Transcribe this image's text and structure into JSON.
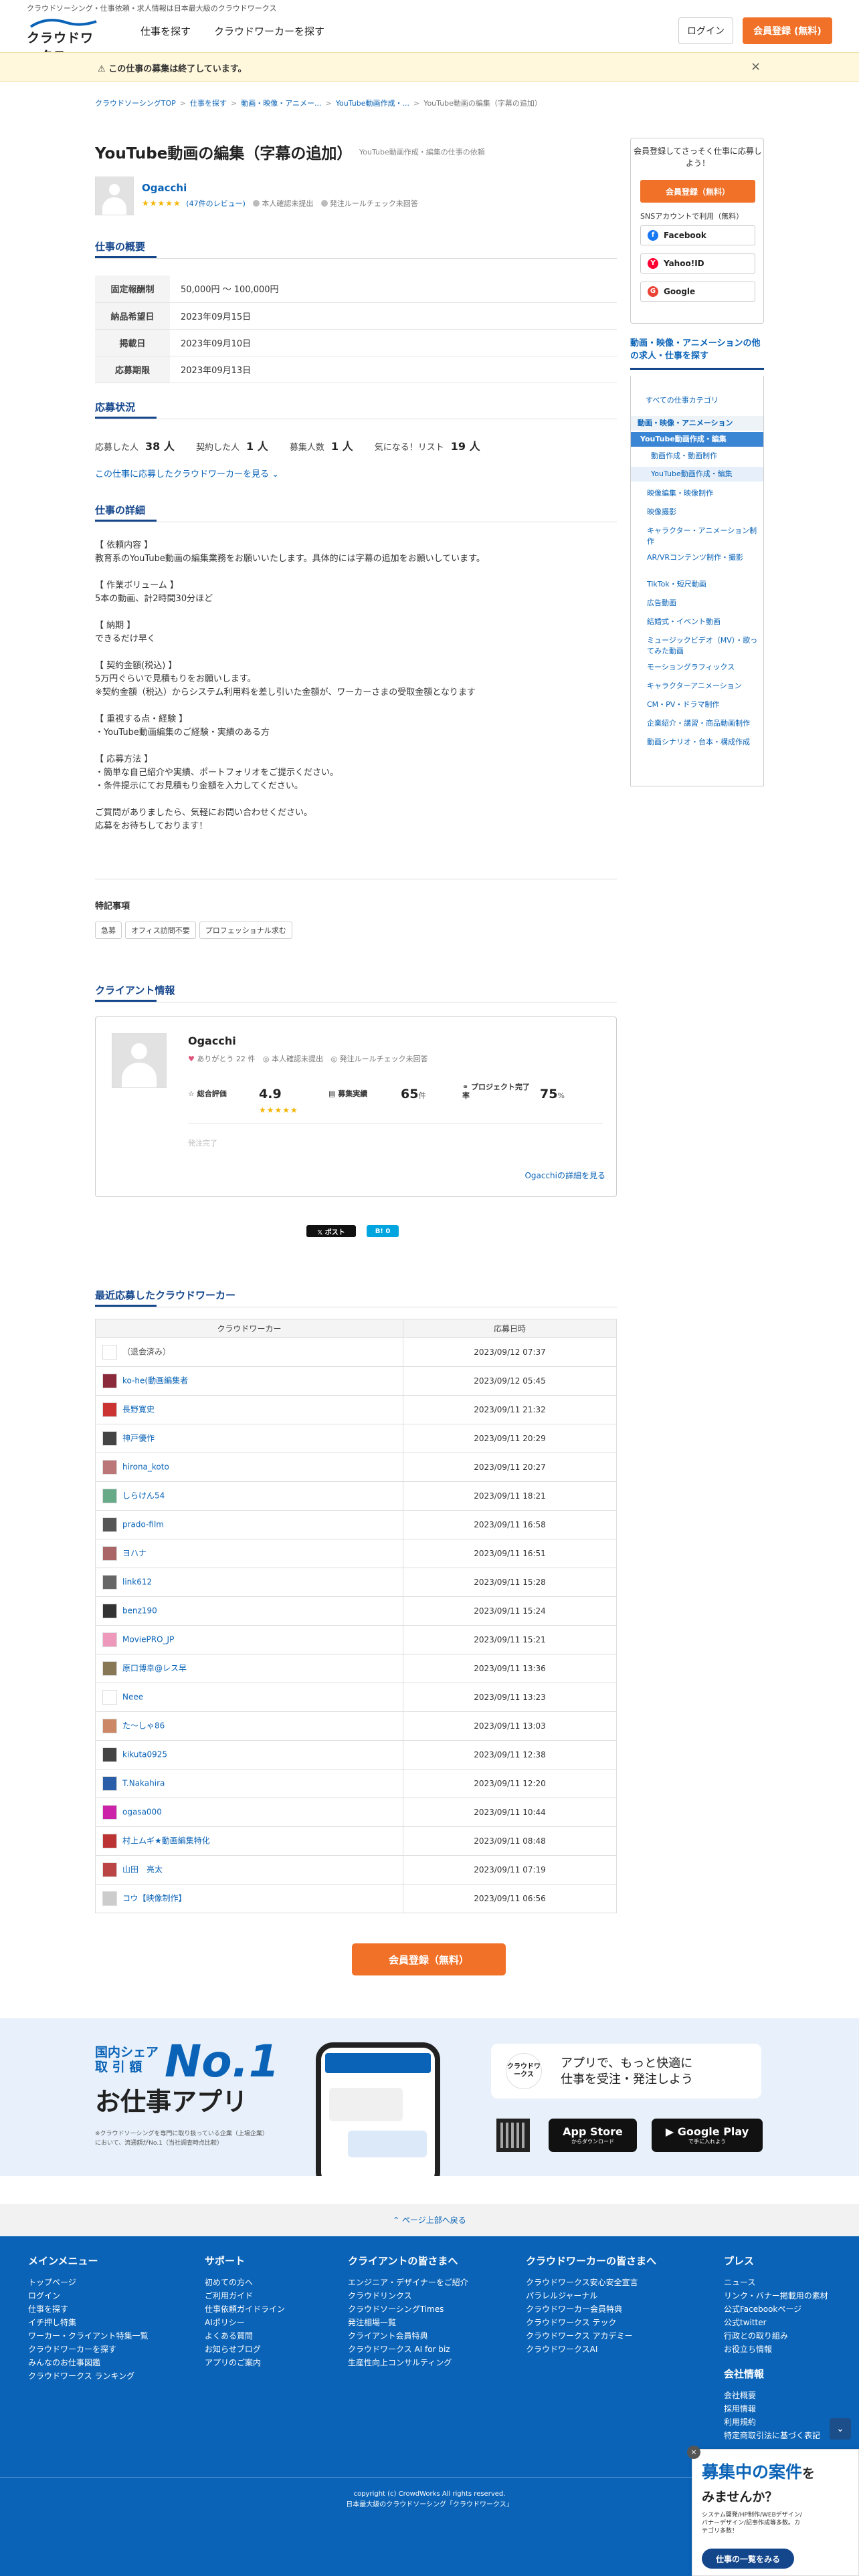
{
  "header": {
    "tagline": "クラウドソーシング・仕事依頼・求人情報は日本最大級のクラウドワークス",
    "logo_text": "クラウドワークス",
    "nav": [
      "仕事を探す",
      "クラウドワーカーを探す"
    ],
    "login": "ログイン",
    "register": "会員登録 (無料)"
  },
  "notice": {
    "text": "この仕事の募集は終了しています。",
    "close": "×"
  },
  "breadcrumb": [
    "クラウドソーシングTOP",
    "仕事を探す",
    "動画・映像・アニメー...",
    "YouTube動画作成・...",
    "YouTube動画の編集（字幕の追加）"
  ],
  "job": {
    "title": "YouTube動画の編集（字幕の追加）",
    "subcategory": "YouTube動画作成・編集の仕事の依頼",
    "client": {
      "name": "Ogacchi",
      "stars": "★★★★★",
      "reviews": "(47件のレビュー)",
      "identity": "本人確認未提出",
      "rule_check": "発注ルールチェック未回答"
    }
  },
  "overview": {
    "heading": "仕事の概要",
    "rows": [
      {
        "k": "固定報酬制",
        "v": "50,000円 〜 100,000円"
      },
      {
        "k": "納品希望日",
        "v": "2023年09月15日"
      },
      {
        "k": "掲載日",
        "v": "2023年09月10日"
      },
      {
        "k": "応募期限",
        "v": "2023年09月13日"
      }
    ]
  },
  "status": {
    "heading": "応募状況",
    "applied_label": "応募した人",
    "applied": "38 人",
    "contracted_label": "契約した人",
    "contracted": "1 人",
    "recruit_label": "募集人数",
    "recruit": "1 人",
    "wishlist_label": "気になる！リスト",
    "wishlist": "19 人",
    "link": "この仕事に応募したクラウドワーカーを見る ⌄"
  },
  "detail": {
    "heading": "仕事の詳細",
    "body": "【 依頼内容 】\n教育系のYouTube動画の編集業務をお願いいたします。具体的には字幕の追加をお願いしています。\n\n【 作業ボリューム 】\n5本の動画、計2時間30分ほど\n\n【 納期 】\nできるだけ早く\n\n【 契約金額(税込) 】\n5万円ぐらいで見積もりをお願いします。\n※契約金額（税込）からシステム利用料を差し引いた金額が、ワーカーさまの受取金額となります\n\n【 重視する点・経験 】\n・YouTube動画編集のご経験・実績のある方\n\n【 応募方法 】\n・簡単な自己紹介や実績、ポートフォリオをご提示ください。\n・条件提示にてお見積もり金額を入力してください。\n\nご質問がありましたら、気軽にお問い合わせください。\n応募をお待ちしております！",
    "features_heading": "特記事項",
    "tags": [
      "急募",
      "オフィス訪問不要",
      "プロフェッショナル求む"
    ]
  },
  "client_info": {
    "heading": "クライアント情報",
    "name": "Ogacchi",
    "thanks": "ありがとう 22 件",
    "identity": "本人確認未提出",
    "rule_check": "発注ルールチェック未回答",
    "rating_label": "総合評価",
    "rating": "4.9",
    "rating_stars": "★★★★★",
    "results_label": "募集実績",
    "results": "65",
    "results_unit": "件",
    "completion_label": "プロジェクト完了率",
    "completion": "75",
    "completion_unit": "%",
    "footer_text": "発注完了",
    "more": "Ogacchiの詳細を見る"
  },
  "share": {
    "x": "𝕏 ポスト",
    "hatena": "B! 0"
  },
  "workers": {
    "heading": "最近応募したクラウドワーカー",
    "col_worker": "クラウドワーカー",
    "col_date": "応募日時",
    "rows": [
      {
        "name": "（退会済み）",
        "date": "2023/09/12 07:37",
        "anon": true,
        "c": "#fff"
      },
      {
        "name": "ko-he(動画編集者",
        "date": "2023/09/12 05:45",
        "c": "#8a2a3a"
      },
      {
        "name": "長野寛史",
        "date": "2023/09/11 21:32",
        "c": "#c33"
      },
      {
        "name": "神戸優作",
        "date": "2023/09/11 20:29",
        "c": "#444"
      },
      {
        "name": "hirona_koto",
        "date": "2023/09/11 20:27",
        "c": "#b77"
      },
      {
        "name": "しらけん54",
        "date": "2023/09/11 18:21",
        "c": "#6a8"
      },
      {
        "name": "prado-film",
        "date": "2023/09/11 16:58",
        "c": "#555"
      },
      {
        "name": "ヨハナ",
        "date": "2023/09/11 16:51",
        "c": "#a66"
      },
      {
        "name": "link612",
        "date": "2023/09/11 15:28",
        "c": "#666"
      },
      {
        "name": "benz190",
        "date": "2023/09/11 15:24",
        "c": "#333"
      },
      {
        "name": "MoviePRO_JP",
        "date": "2023/09/11 15:21",
        "c": "#e9b"
      },
      {
        "name": "原口博幸@レス早",
        "date": "2023/09/11 13:36",
        "c": "#875"
      },
      {
        "name": "Neee",
        "date": "2023/09/11 13:23",
        "c": "#fff"
      },
      {
        "name": "た～しゃ86",
        "date": "2023/09/11 13:03",
        "c": "#c86"
      },
      {
        "name": "kikuta0925",
        "date": "2023/09/11 12:38",
        "c": "#444"
      },
      {
        "name": "T.Nakahira",
        "date": "2023/09/11 12:20",
        "c": "#2a5ea8"
      },
      {
        "name": "ogasa000",
        "date": "2023/09/11 10:44",
        "c": "#c2a"
      },
      {
        "name": "村上ムギ★動画編集特化",
        "date": "2023/09/11 08:48",
        "c": "#b33"
      },
      {
        "name": "山田　亮太",
        "date": "2023/09/11 07:19",
        "c": "#b44"
      },
      {
        "name": "コウ【映像制作】",
        "date": "2023/09/11 06:56",
        "c": "#ccc"
      }
    ]
  },
  "cta": "会員登録（無料）",
  "promo": {
    "share_line1": "国内シェア",
    "share_line2": "取 引 額",
    "no1": "No.1",
    "app": "お仕事アプリ",
    "note": "※クラウドソーシングを専門に取り扱っている企業（上場企業）において、流通額がNo.1（当社調査時点比較）",
    "logo": "クラウドワークス",
    "headline1": "アプリで、もっと快適に",
    "headline2": "仕事を受注・発注しよう",
    "appstore": "App Store",
    "appstore_sub": "からダウンロード",
    "gplay": "Google Play",
    "gplay_sub": "で手に入れよう"
  },
  "gotop": "⌃ ページ上部へ戻る",
  "footer": {
    "cols": [
      {
        "h": "メインメニュー",
        "items": [
          "トップページ",
          "ログイン",
          "仕事を探す",
          "イチ押し特集",
          "ワーカー・クライアント特集一覧",
          "クラウドワーカーを探す",
          "みんなのお仕事図鑑",
          "クラウドワークス ランキング"
        ]
      },
      {
        "h": "サポート",
        "items": [
          "初めての方へ",
          "ご利用ガイド",
          "仕事依頼ガイドライン",
          "AIポリシー",
          "よくある質問",
          "お知らせブログ",
          "アプリのご案内"
        ]
      },
      {
        "h": "クライアントの皆さまへ",
        "items": [
          "エンジニア・デザイナーをご紹介",
          "クラウドリンクス",
          "クラウドソーシングTimes",
          "発注相場一覧",
          "クライアント会員特典",
          "クラウドワークス AI for biz",
          "生産性向上コンサルティング"
        ]
      },
      {
        "h": "クラウドワーカーの皆さまへ",
        "items": [
          "クラウドワークス安心安全宣言",
          "パラレルジャーナル",
          "クラウドワーカー会員特典",
          "クラウドワークス テック",
          "クラウドワークス アカデミー",
          "クラウドワークスAI"
        ]
      },
      {
        "h": "プレス",
        "items": [
          "ニュース",
          "リンク・バナー掲載用の素材",
          "公式Facebookページ",
          "公式twitter",
          "行政との取り組み",
          "お役立ち情報"
        ]
      }
    ],
    "company_h": "会社情報",
    "company": [
      "会社概要",
      "採用情報",
      "利用規約",
      "特定商取引法に基づく表記"
    ],
    "copyright": "copyright (c) CrowdWorks All rights reserved.",
    "tagline": "日本最大級のクラウドソーシング「クラウドワークス」"
  },
  "sidebar": {
    "reg_text": "会員登録してさっそく仕事に応募しよう！",
    "reg_btn": "会員登録（無料）",
    "sns_label": "SNSアカウントで利用（無料）",
    "sns": [
      "Facebook",
      "Yahoo!ID",
      "Google"
    ],
    "cat_heading": "動画・映像・アニメーションの他の求人・仕事を探す",
    "all": "すべての仕事カテゴリ",
    "cat": "動画・映像・アニメーション",
    "selected": "YouTube動画作成・編集",
    "subs": [
      "動画作成・動画制作",
      "YouTube動画作成・編集"
    ],
    "items": [
      "映像編集・映像制作",
      "映像撮影",
      "キャラクター・アニメーション制作",
      "AR/VRコンテンツ制作・撮影",
      "TikTok・短尺動画",
      "広告動画",
      "結婚式・イベント動画",
      "ミュージックビデオ（MV）・歌ってみた動画",
      "モーショングラフィックス",
      "キャラクターアニメーション",
      "CM・PV・ドラマ制作",
      "企業紹介・講習・商品動画制作",
      "動画シナリオ・台本・構成作成"
    ]
  },
  "banner": {
    "l1": "募集中の案件",
    "l1b": "を",
    "l2": "みませんか？",
    "l3": "システム開発/HP制作/WEBデザイン/バナーデザイン/記事作成等多数。カテゴリ多数！",
    "btn": "仕事の一覧をみる",
    "close": "×"
  },
  "colors": {
    "brand": "#0a63b7",
    "accent": "#f07127"
  }
}
